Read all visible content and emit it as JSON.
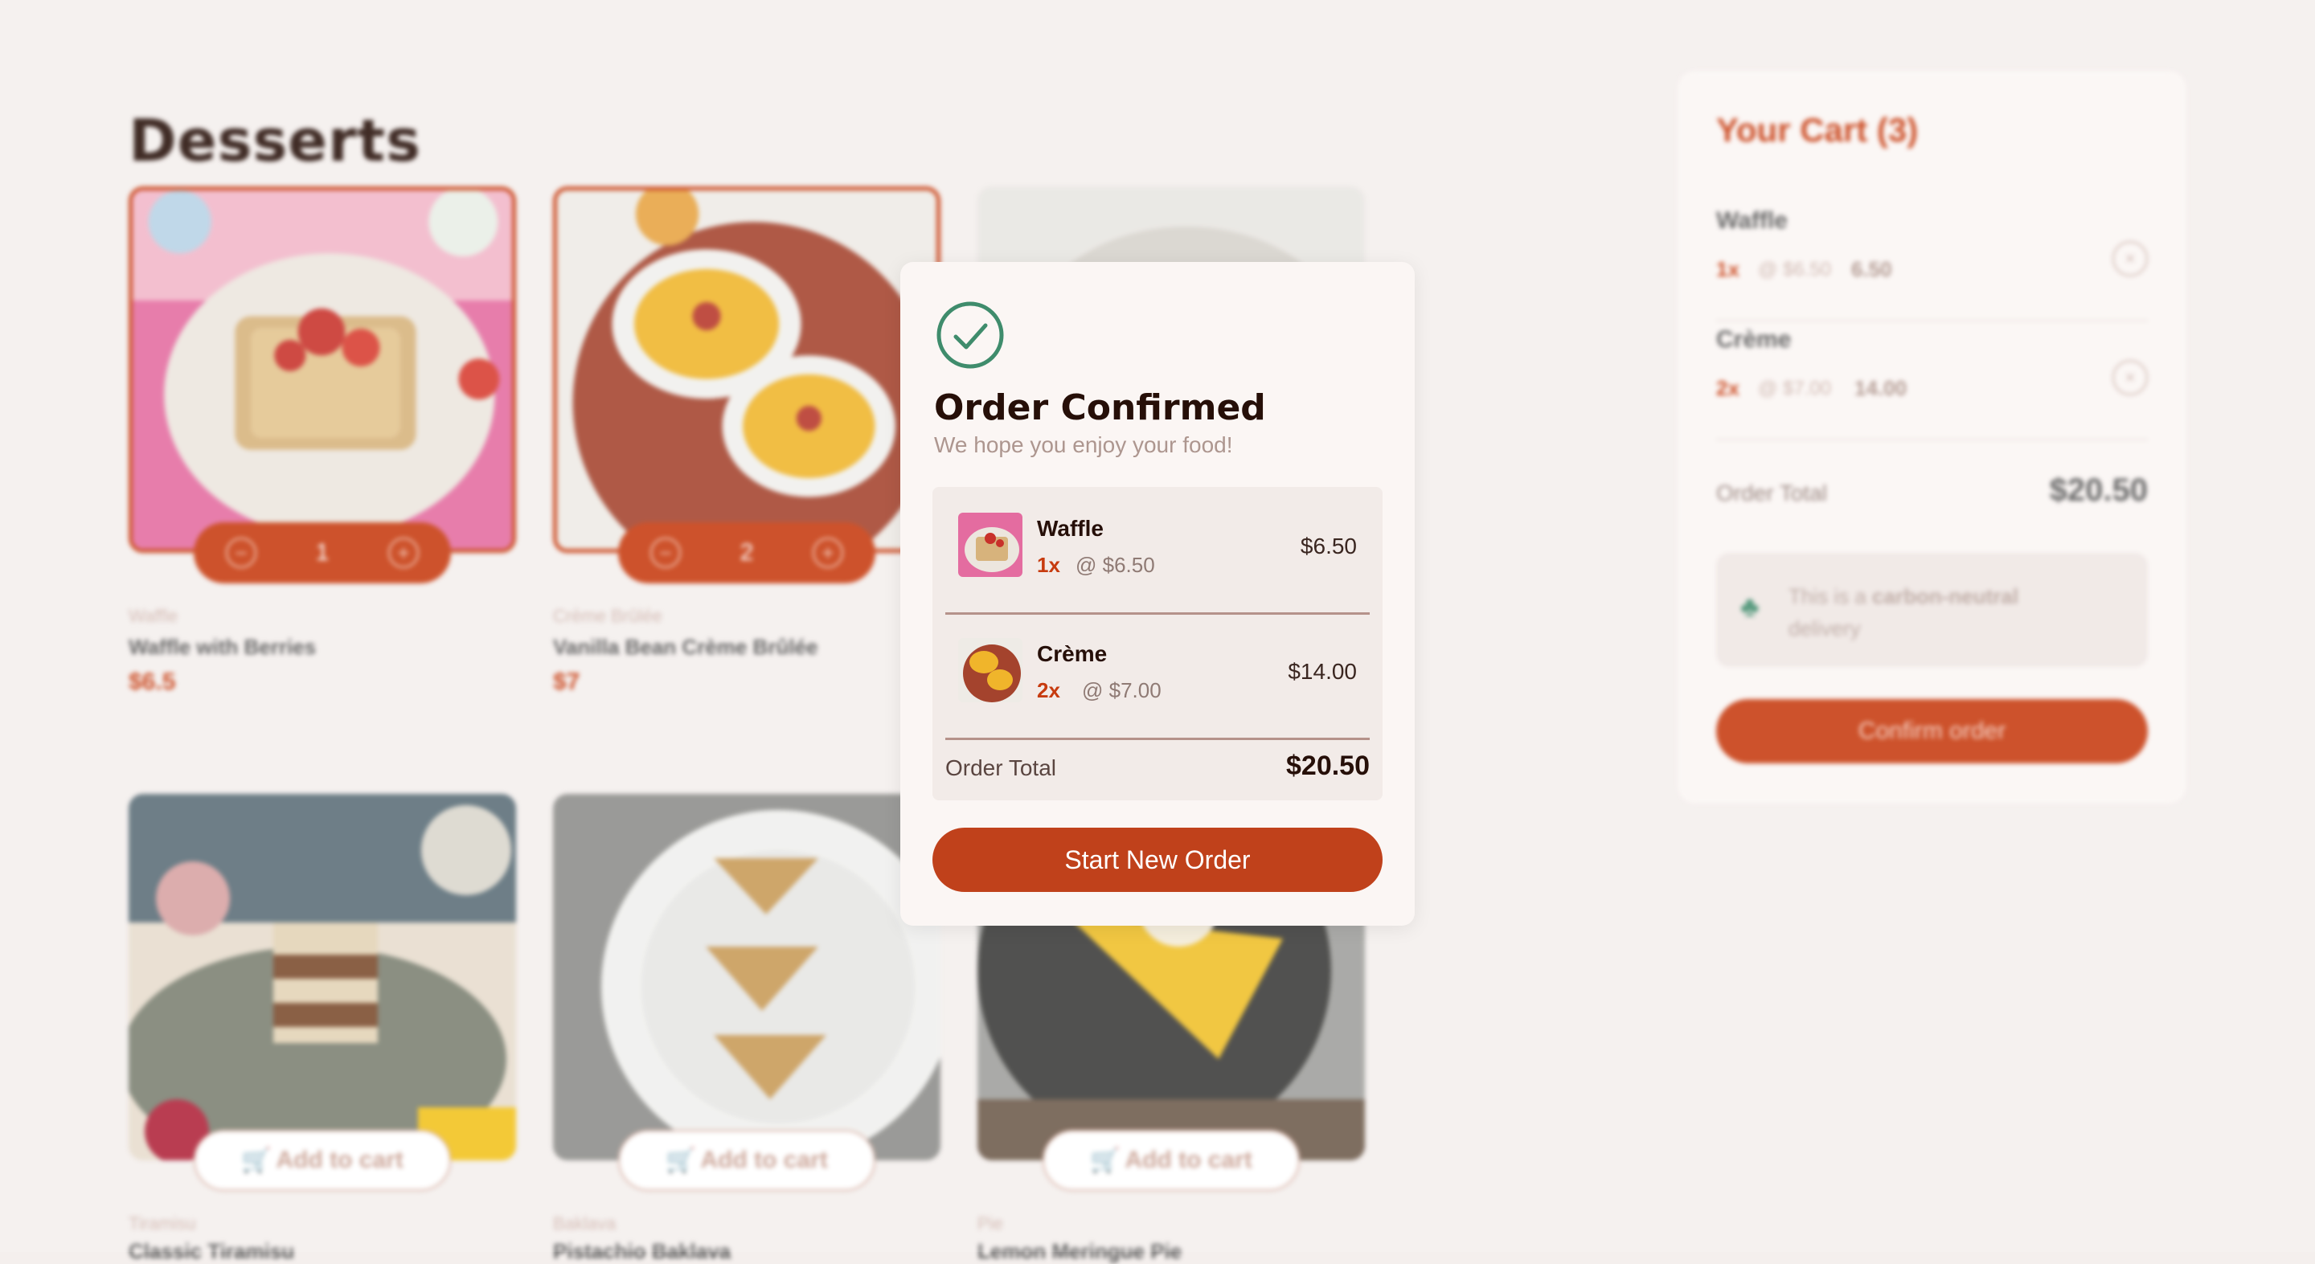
{
  "page": {
    "title": "Desserts"
  },
  "products": [
    {
      "category": "Waffle",
      "name": "Waffle with Berries",
      "price": "$6.5",
      "quantity": "1",
      "selected": true
    },
    {
      "category": "Crème Brûlée",
      "name": "Vanilla Bean Crème Brûlée",
      "price": "$7",
      "quantity": "2",
      "selected": true
    },
    {
      "category": "",
      "name": "",
      "price": "",
      "selected": false
    },
    {
      "category": "Tiramisu",
      "name": "Classic Tiramisu",
      "add_label": "Add to cart"
    },
    {
      "category": "Baklava",
      "name": "Pistachio Baklava",
      "add_label": "Add to cart"
    },
    {
      "category": "Pie",
      "name": "Lemon Meringue Pie",
      "add_label": "Add to cart"
    }
  ],
  "cart": {
    "title": "Your Cart (3)",
    "items": [
      {
        "name": "Waffle",
        "qty": "1x",
        "unit": "@ $6.50",
        "total": "6.50"
      },
      {
        "name": "Crème",
        "qty": "2x",
        "unit": "@ $7.00",
        "total": "14.00"
      }
    ],
    "total_label": "Order Total",
    "total_value": "$20.50",
    "neutral_text_1": "This is a ",
    "neutral_bold": "carbon-neutral",
    "neutral_text_2": " delivery",
    "confirm_label": "Confirm order"
  },
  "modal": {
    "title": "Order Confirmed",
    "subtitle": "We hope you enjoy your food!",
    "items": [
      {
        "name": "Waffle",
        "qty": "1x",
        "unit": "@ $6.50",
        "total": "$6.50"
      },
      {
        "name": "Crème",
        "qty": "2x",
        "unit": "@ $7.00",
        "total": "$14.00"
      }
    ],
    "total_label": "Order Total",
    "total_value": "$20.50",
    "button_label": "Start New Order"
  },
  "colors": {
    "accent": "#c73b0f",
    "success": "#3f8c6c",
    "background": "#f4efed"
  },
  "icons": [
    "check-circle-icon",
    "remove-item-icon",
    "tree-icon",
    "add-to-cart-icon",
    "decrement-icon",
    "increment-icon"
  ]
}
